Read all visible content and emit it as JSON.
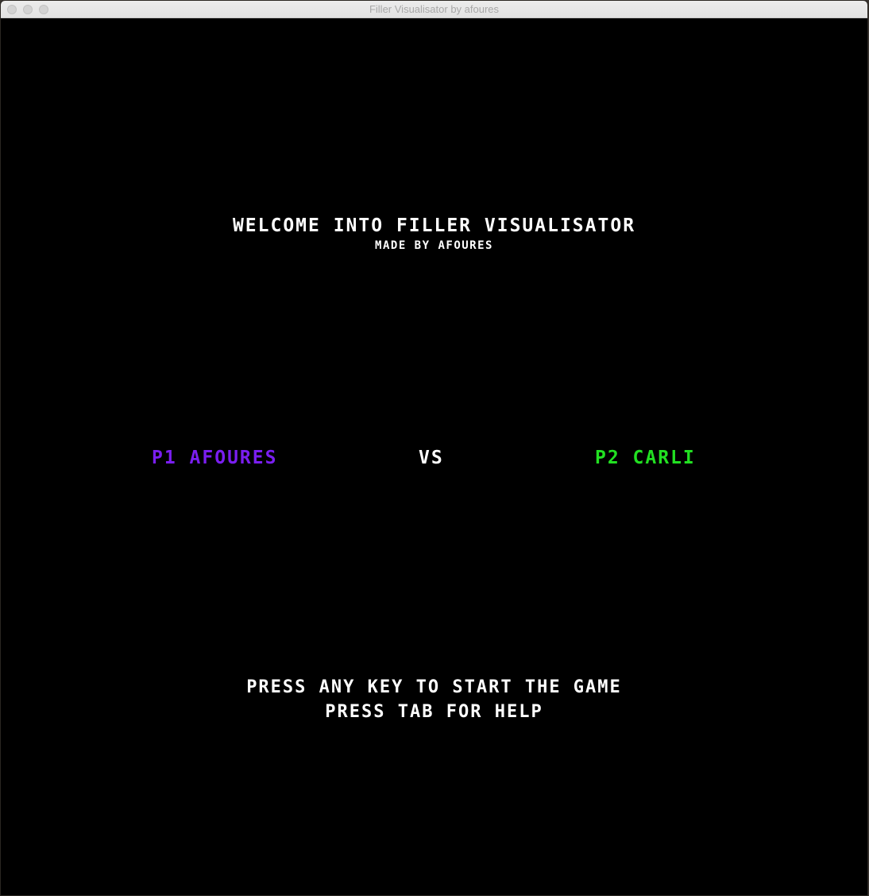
{
  "window": {
    "title": "Filler Visualisator by afoures"
  },
  "screen": {
    "welcome": "WELCOME INTO FILLER VISUALISATOR",
    "made_by": "MADE BY AFOURES",
    "player1": "P1 AFOURES",
    "versus": "VS",
    "player2": "P2 CARLI",
    "press_start": "PRESS ANY KEY TO START THE GAME",
    "press_tab": "PRESS TAB FOR HELP"
  },
  "colors": {
    "background": "#000000",
    "text": "#ffffff",
    "player1": "#7a1ef0",
    "player2": "#22e022"
  }
}
